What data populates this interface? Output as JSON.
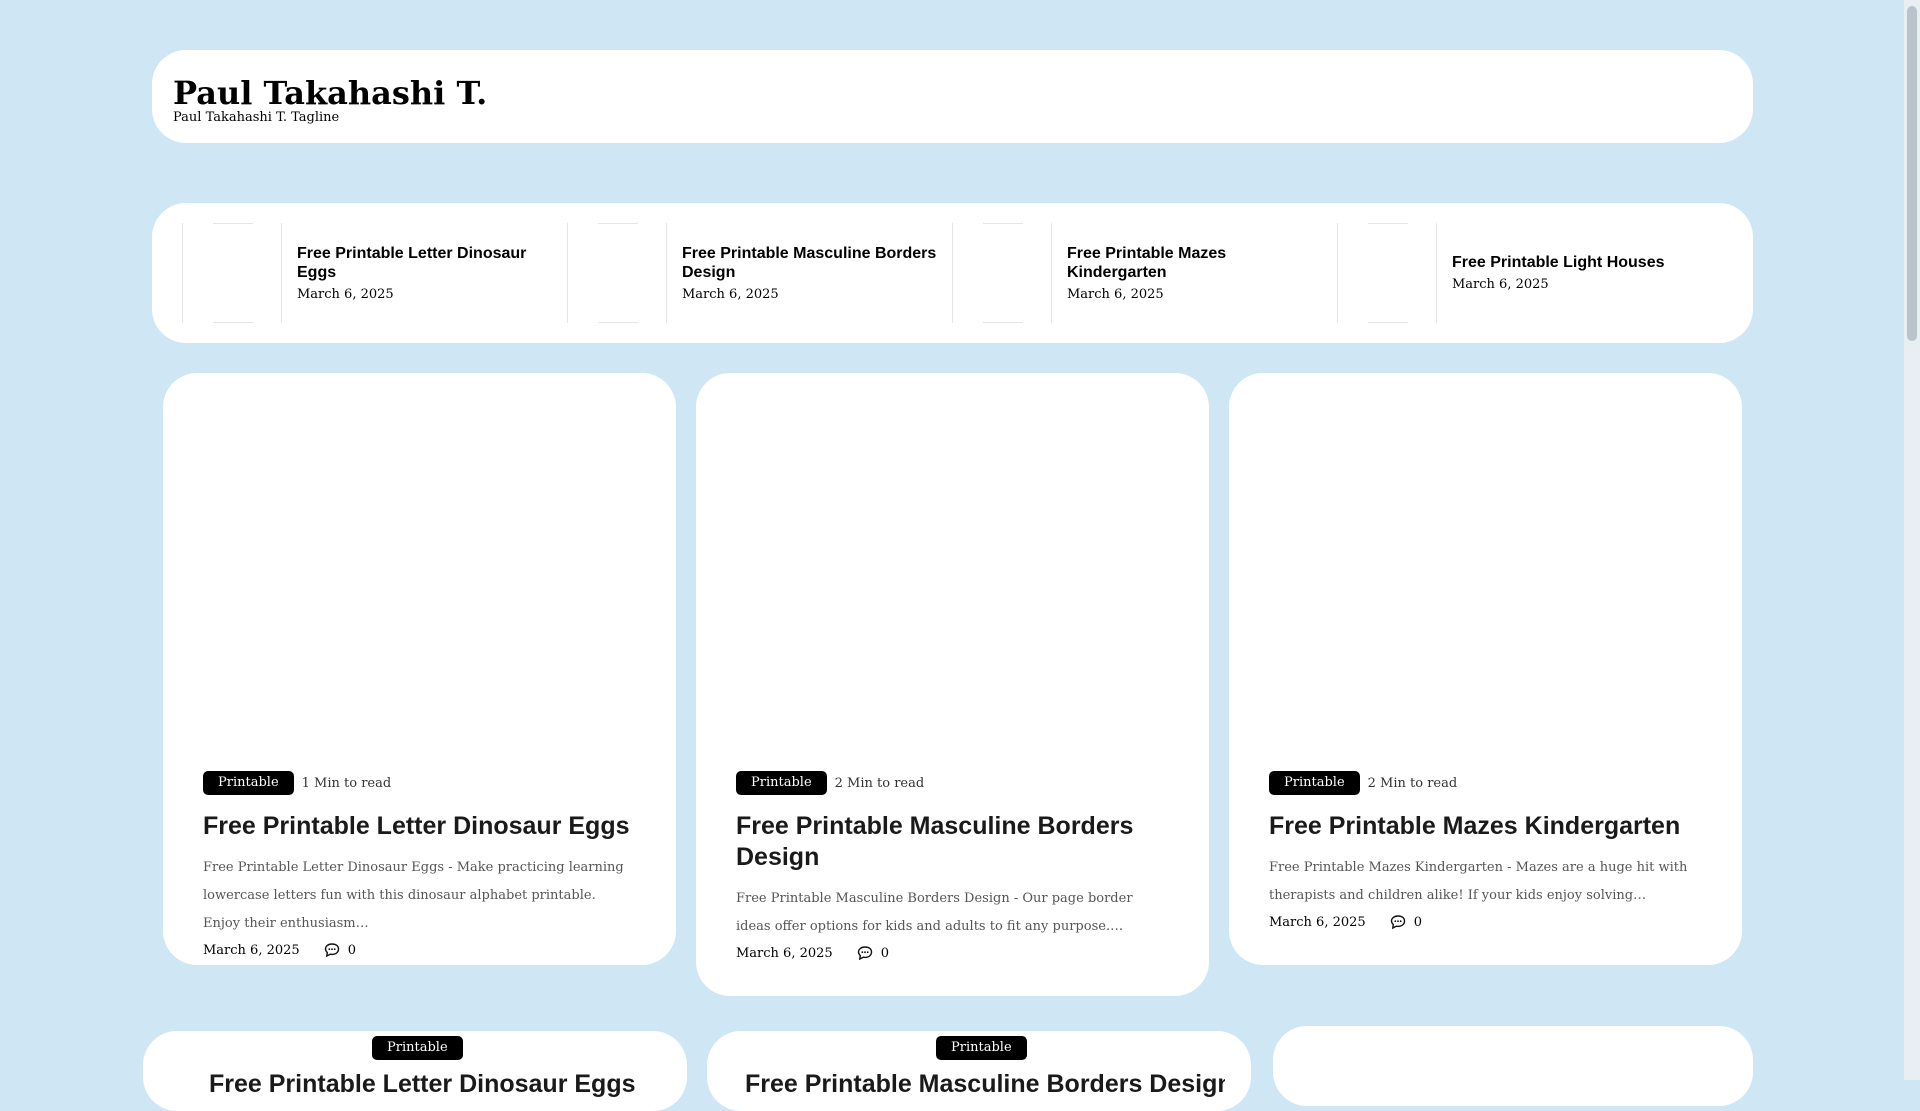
{
  "site": {
    "title": "Paul Takahashi T.",
    "tagline": "Paul Takahashi T. Tagline"
  },
  "recent_posts": [
    {
      "title": "Free Printable Letter Dinosaur Eggs",
      "date": "March 6, 2025"
    },
    {
      "title": "Free Printable Masculine Borders Design",
      "date": "March 6, 2025"
    },
    {
      "title": "Free Printable Mazes Kindergarten",
      "date": "March 6, 2025"
    },
    {
      "title": "Free Printable Light Houses",
      "date": "March 6, 2025"
    }
  ],
  "cards": [
    {
      "category": "Printable",
      "read_time": "1 Min to read",
      "title": "Free Printable Letter Dinosaur Eggs",
      "excerpt": "Free Printable Letter Dinosaur Eggs - Make practicing learning lowercase letters fun with this dinosaur alphabet printable. Enjoy their enthusiasm…",
      "date": "March 6, 2025",
      "comments": "0"
    },
    {
      "category": "Printable",
      "read_time": "2 Min to read",
      "title": "Free Printable Masculine Borders Design",
      "excerpt": "Free Printable Masculine Borders Design - Our page border ideas offer options for kids and adults to fit any purpose.…",
      "date": "March 6, 2025",
      "comments": "0"
    },
    {
      "category": "Printable",
      "read_time": "2 Min to read",
      "title": "Free Printable Mazes Kindergarten",
      "excerpt": "Free Printable Mazes Kindergarten - Mazes are a huge hit with therapists and children alike! If your kids enjoy solving…",
      "date": "March 6, 2025",
      "comments": "0"
    }
  ],
  "bottom_cards": [
    {
      "category": "Printable",
      "title": "Free Printable Letter Dinosaur Eggs"
    },
    {
      "category": "Printable",
      "title": "Free Printable Masculine Borders Design"
    }
  ],
  "icons": {
    "comment": "speech-bubble-icon"
  }
}
